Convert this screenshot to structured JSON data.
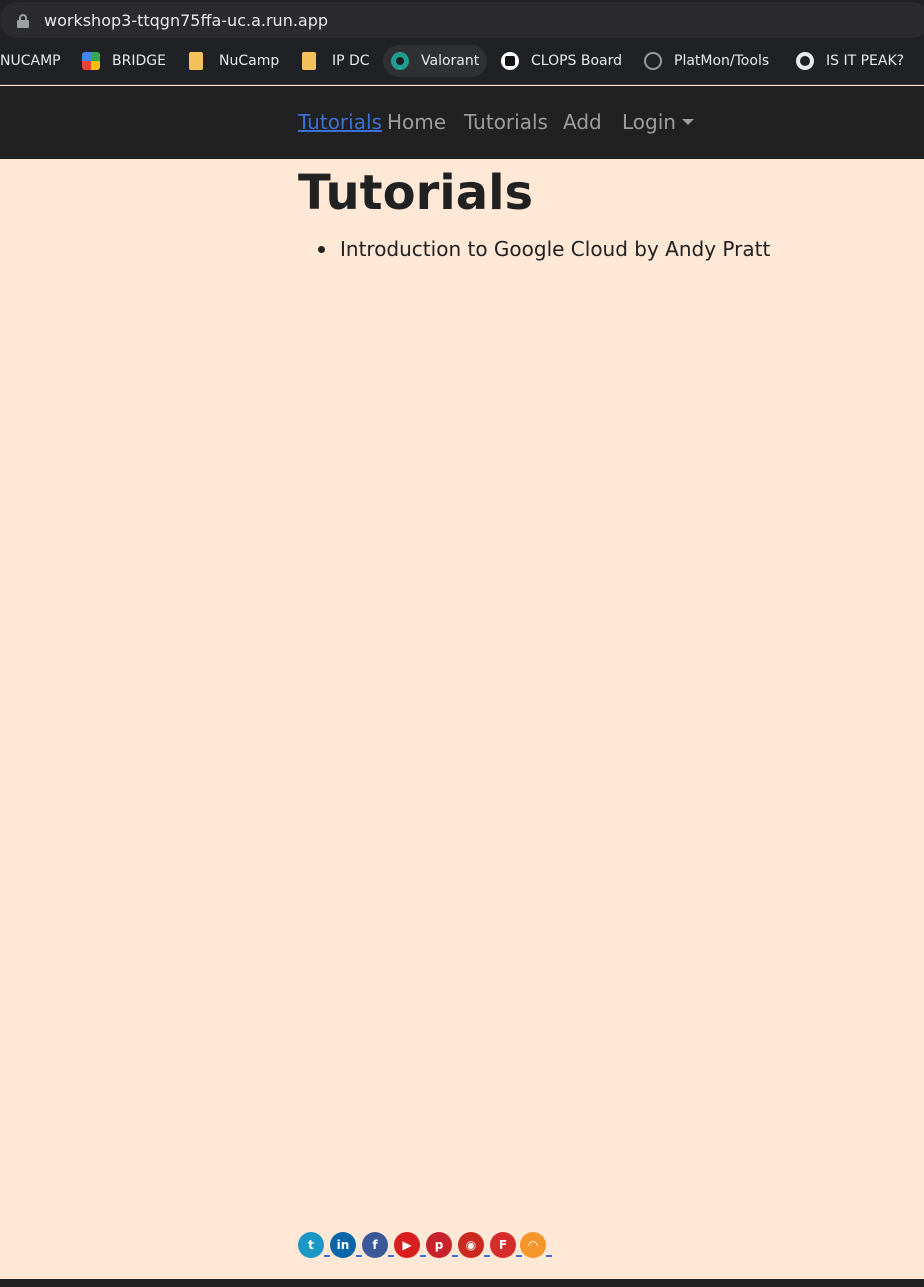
{
  "browser": {
    "url": "workshop3-ttqgn75ffa-uc.a.run.app",
    "bookmarks": [
      {
        "label": "NUCAMP",
        "icon": "none"
      },
      {
        "label": "BRIDGE",
        "icon": "google-meet-icon"
      },
      {
        "label": "NuCamp",
        "icon": "folder-icon"
      },
      {
        "label": "IP DC",
        "icon": "folder-icon"
      },
      {
        "label": "Valorant",
        "icon": "valorant-icon"
      },
      {
        "label": "CLOPS Board",
        "icon": "clops-icon"
      },
      {
        "label": "PlatMon/Tools",
        "icon": "platmon-icon"
      },
      {
        "label": "IS IT PEAK?",
        "icon": "github-icon"
      }
    ]
  },
  "navbar": {
    "brand": "Tutorials",
    "links": [
      "Home",
      "Tutorials",
      "Add",
      "Login"
    ]
  },
  "main": {
    "title": "Tutorials",
    "tutorials": [
      "Introduction to Google Cloud by Andy Pratt"
    ]
  },
  "footer": {
    "social": [
      {
        "name": "twitter",
        "glyph": "t",
        "color": "#1c98c4"
      },
      {
        "name": "linkedin",
        "glyph": "in",
        "color": "#0a66a8"
      },
      {
        "name": "facebook",
        "glyph": "f",
        "color": "#3b5998"
      },
      {
        "name": "youtube",
        "glyph": "▶",
        "color": "#d81e1e"
      },
      {
        "name": "pinterest",
        "glyph": "p",
        "color": "#c8232c"
      },
      {
        "name": "reddit",
        "glyph": "◉",
        "color": "#c9291f"
      },
      {
        "name": "flipboard",
        "glyph": "F",
        "color": "#d62c2c"
      },
      {
        "name": "rss",
        "glyph": "◠",
        "color": "#f7962b"
      }
    ]
  }
}
